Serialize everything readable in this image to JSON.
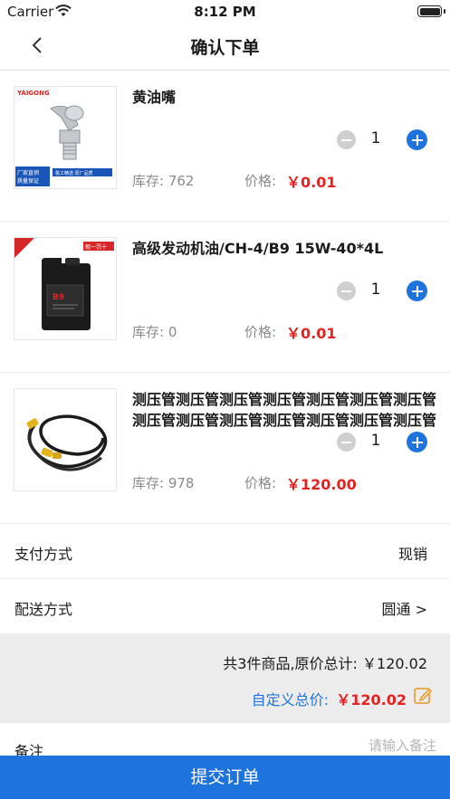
{
  "status_bar": {
    "carrier": "Carrier",
    "time": "8:12 PM"
  },
  "nav": {
    "title": "确认下单"
  },
  "products": [
    {
      "name": "黄油嘴",
      "quantity": "1",
      "stock": "库存: 762",
      "price_label": "价格:",
      "price": "￥0.01",
      "image_text": {
        "brand": "YAIGONG",
        "badge": "厂家直销\n质量保证",
        "tag": "极工精选 原厂品质"
      }
    },
    {
      "name": "高级发动机油/CH-4/B9 15W-40*4L",
      "quantity": "1",
      "stock": "库存: 0",
      "price_label": "价格:",
      "price": "￥0.01",
      "image_text": {
        "corner": "假一罚十",
        "label": "B9"
      }
    },
    {
      "name": "测压管测压管测压管测压管测压管测压管测压管测压管测压管测压管测压管测压管测压管测压管",
      "quantity": "1",
      "stock": "库存: 978",
      "price_label": "价格:",
      "price": "￥120.00"
    }
  ],
  "payment": {
    "label": "支付方式",
    "value": "现销"
  },
  "delivery": {
    "label": "配送方式",
    "value": "圆通 >"
  },
  "summary": {
    "line": "共3件商品,原价总计: ￥120.02",
    "custom_label": "自定义总价:",
    "custom_value": "￥120.02"
  },
  "remark": {
    "label": "备注",
    "placeholder": "请输入备注"
  },
  "submit": {
    "label": "提交订单"
  },
  "colors": {
    "accent": "#1f73dd",
    "price": "#e52121",
    "summary_bg": "#ececec"
  },
  "icons": [
    "wifi-icon",
    "battery-icon",
    "back-chevron-icon",
    "minus-icon",
    "plus-icon",
    "edit-icon"
  ]
}
